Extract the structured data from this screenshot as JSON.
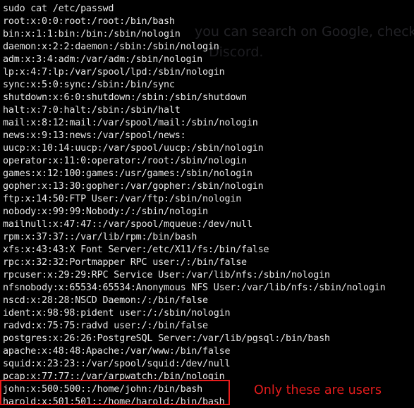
{
  "terminal": {
    "lines": [
      "sudo cat /etc/passwd",
      "root:x:0:0:root:/root:/bin/bash",
      "bin:x:1:1:bin:/bin:/sbin/nologin",
      "daemon:x:2:2:daemon:/sbin:/sbin/nologin",
      "adm:x:3:4:adm:/var/adm:/sbin/nologin",
      "lp:x:4:7:lp:/var/spool/lpd:/sbin/nologin",
      "sync:x:5:0:sync:/sbin:/bin/sync",
      "shutdown:x:6:0:shutdown:/sbin:/sbin/shutdown",
      "halt:x:7:0:halt:/sbin:/sbin/halt",
      "mail:x:8:12:mail:/var/spool/mail:/sbin/nologin",
      "news:x:9:13:news:/var/spool/news:",
      "uucp:x:10:14:uucp:/var/spool/uucp:/sbin/nologin",
      "operator:x:11:0:operator:/root:/sbin/nologin",
      "games:x:12:100:games:/usr/games:/sbin/nologin",
      "gopher:x:13:30:gopher:/var/gopher:/sbin/nologin",
      "ftp:x:14:50:FTP User:/var/ftp:/sbin/nologin",
      "nobody:x:99:99:Nobody:/:/sbin/nologin",
      "mailnull:x:47:47::/var/spool/mqueue:/dev/null",
      "rpm:x:37:37::/var/lib/rpm:/bin/bash",
      "xfs:x:43:43:X Font Server:/etc/X11/fs:/bin/false",
      "rpc:x:32:32:Portmapper RPC user:/:/bin/false",
      "rpcuser:x:29:29:RPC Service User:/var/lib/nfs:/sbin/nologin",
      "nfsnobody:x:65534:65534:Anonymous NFS User:/var/lib/nfs:/sbin/nologin",
      "nscd:x:28:28:NSCD Daemon:/:/bin/false",
      "ident:x:98:98:pident user:/:/sbin/nologin",
      "radvd:x:75:75:radvd user:/:/bin/false",
      "postgres:x:26:26:PostgreSQL Server:/var/lib/pgsql:/bin/bash",
      "apache:x:48:48:Apache:/var/www:/bin/false",
      "squid:x:23:23::/var/spool/squid:/dev/null",
      "pcap:x:77:77::/var/arpwatch:/bin/nologin",
      "john:x:500:500::/home/john:/bin/bash",
      "harold:x:501:501::/home/harold:/bin/bash"
    ]
  },
  "annotation": {
    "text": "Only these are users"
  },
  "background_ghost": {
    "line1": "you can search on Google, check d",
    "line2": "Discord.",
    "line3": ""
  },
  "colors": {
    "background": "#000000",
    "text": "#e6e6e6",
    "highlight": "#e81c1c"
  }
}
